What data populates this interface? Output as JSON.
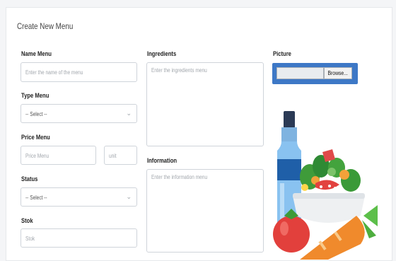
{
  "form": {
    "title": "Create New Menu",
    "name": {
      "label": "Name Menu",
      "placeholder": "Enter the name of the menu"
    },
    "type": {
      "label": "Type Menu",
      "selected": "-- Select --"
    },
    "price": {
      "label": "Price Menu",
      "placeholder": "Price Menu",
      "unit_placeholder": "unit"
    },
    "status": {
      "label": "Status",
      "selected": "-- Select --"
    },
    "stock": {
      "label": "Stok",
      "placeholder": "Stok"
    },
    "ingredients": {
      "label": "Ingredients",
      "placeholder": "Enter the ingredients menu"
    },
    "information": {
      "label": "Information",
      "placeholder": "Enter the information menu"
    },
    "picture": {
      "label": "Picture",
      "browse_label": "Browse..."
    }
  },
  "illustration": {
    "icon": "food-illustration"
  },
  "colors": {
    "accent": "#3d78c6"
  }
}
